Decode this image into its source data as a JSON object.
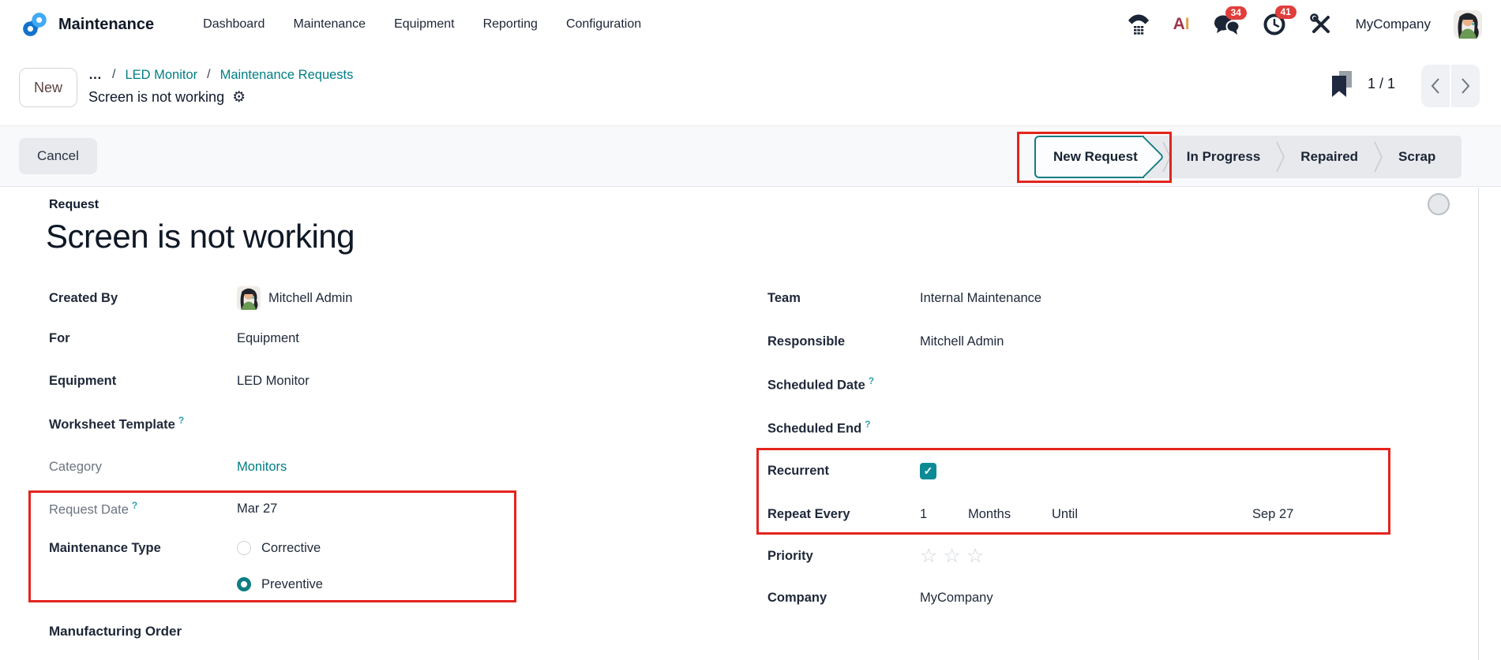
{
  "icons": {
    "gear": "⚙",
    "star": "☆",
    "check": "✓",
    "ellipsis_glyph": "…"
  },
  "navbar": {
    "app_name": "Maintenance",
    "menu": [
      {
        "label": "Dashboard"
      },
      {
        "label": "Maintenance"
      },
      {
        "label": "Equipment"
      },
      {
        "label": "Reporting"
      },
      {
        "label": "Configuration"
      }
    ],
    "ai_letter_a": "A",
    "ai_letter_i": "I",
    "messages_badge": "34",
    "activities_badge": "41",
    "company": "MyCompany"
  },
  "breadcrumb": {
    "new_button": "New",
    "separator": "/",
    "links": [
      {
        "label": "LED Monitor"
      },
      {
        "label": "Maintenance Requests"
      }
    ],
    "current": "Screen is not working",
    "pager_count": "1 / 1"
  },
  "statusbar": {
    "cancel_button": "Cancel",
    "active_stage": "New Request",
    "stages": [
      {
        "label": "New Request"
      },
      {
        "label": "In Progress"
      },
      {
        "label": "Repaired"
      },
      {
        "label": "Scrap"
      }
    ]
  },
  "form": {
    "request_label": "Request",
    "title": "Screen is not working",
    "help_glyph": "?",
    "left": {
      "created_by": {
        "label": "Created By",
        "value": "Mitchell Admin"
      },
      "for_field": {
        "label": "For",
        "value": "Equipment"
      },
      "equipment": {
        "label": "Equipment",
        "value": "LED Monitor"
      },
      "worksheet": {
        "label": "Worksheet Template",
        "value": ""
      },
      "category": {
        "label": "Category",
        "value": "Monitors"
      },
      "request_date": {
        "label": "Request Date",
        "value": "Mar 27"
      },
      "maintenance_type": {
        "label": "Maintenance Type",
        "options": [
          {
            "label": "Corrective",
            "selected": false
          },
          {
            "label": "Preventive",
            "selected": true
          }
        ]
      },
      "manufacturing_order": {
        "label": "Manufacturing Order"
      }
    },
    "right": {
      "team": {
        "label": "Team",
        "value": "Internal Maintenance"
      },
      "responsible": {
        "label": "Responsible",
        "value": "Mitchell Admin"
      },
      "scheduled_date": {
        "label": "Scheduled Date",
        "value": ""
      },
      "scheduled_end": {
        "label": "Scheduled End",
        "value": ""
      },
      "recurrent": {
        "label": "Recurrent",
        "checked": true
      },
      "repeat_every": {
        "label": "Repeat Every",
        "interval": "1",
        "unit": "Months",
        "until_label": "Until",
        "until_value": "Sep 27"
      },
      "priority": {
        "label": "Priority",
        "max_stars": 3,
        "selected_stars": 0
      },
      "company": {
        "label": "Company",
        "value": "MyCompany"
      }
    }
  },
  "colors": {
    "accent": "#017e84",
    "annotation": "#e3241d",
    "badge": "#e03e3c"
  }
}
